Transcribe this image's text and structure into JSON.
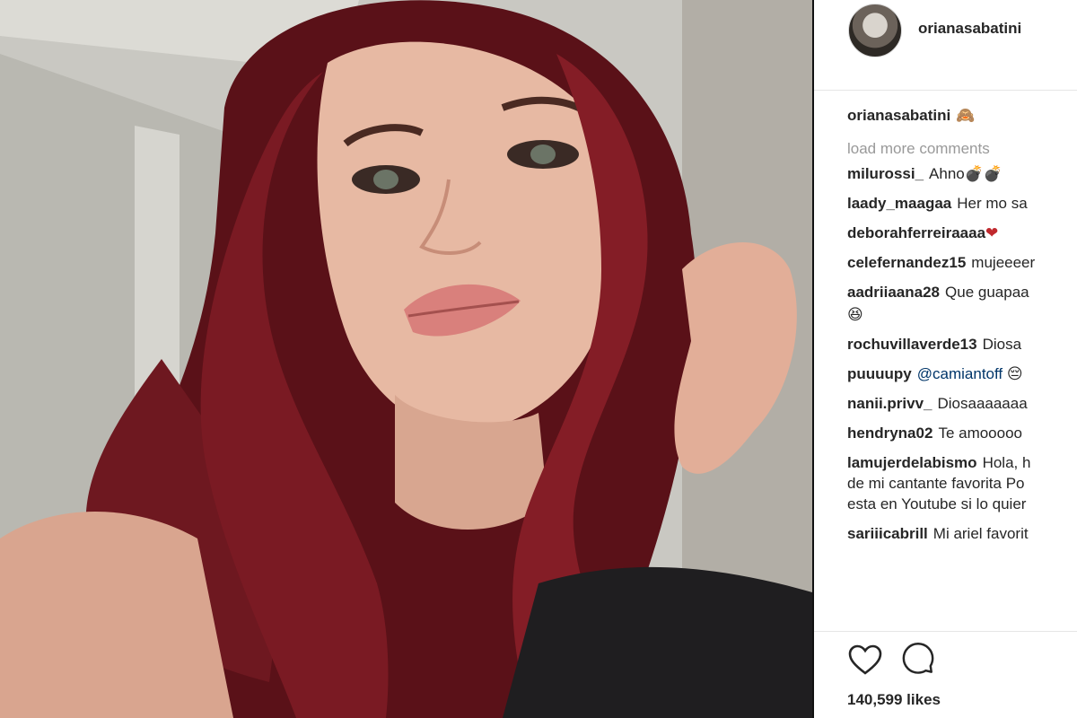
{
  "post": {
    "username": "orianasabatini",
    "caption": {
      "username": "orianasabatini",
      "text": "🙈"
    },
    "load_more": "load more comments",
    "comments": [
      {
        "username": "milurossi_",
        "text": "Ahno💣💣"
      },
      {
        "username": "laady_maagaa",
        "text": "Her mo sa"
      },
      {
        "username": "deborahferreiraaaa",
        "text": "❤"
      },
      {
        "username": "celefernandez15",
        "text": "mujeeeer"
      },
      {
        "username": "aadriiaana28",
        "text": "Que guapaa",
        "text_cont": "😆"
      },
      {
        "username": "rochuvillaverde13",
        "text": "Diosa"
      },
      {
        "username": "puuuupy",
        "mention": "@camiantoff",
        "text": "😔"
      },
      {
        "username": "nanii.privv_",
        "text": "Diosaaaaaaa"
      },
      {
        "username": "hendryna02",
        "text": "Te amooooo"
      },
      {
        "username": "lamujerdelabismo",
        "text": "Hola, h",
        "text_cont": "de mi cantante favorita Po",
        "text_cont2": "esta en Youtube si lo quier"
      },
      {
        "username": "sariiicabrill",
        "text": "Mi ariel favorit"
      }
    ],
    "likes": "140,599 likes",
    "icons": {
      "like": "heart-icon",
      "comment": "comment-bubble-icon"
    }
  }
}
